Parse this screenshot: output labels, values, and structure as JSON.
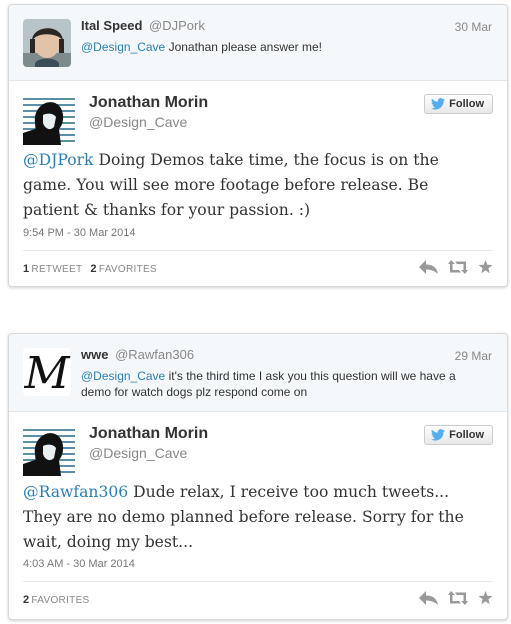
{
  "tweets": [
    {
      "parent": {
        "name": "Ital Speed",
        "handle": "@DJPork",
        "date": "30 Mar",
        "mention": "@Design_Cave",
        "text": " Jonathan please answer me!"
      },
      "author": {
        "name": "Jonathan Morin",
        "handle": "@Design_Cave"
      },
      "follow_label": "Follow",
      "mention": "@DJPork",
      "text": " Doing Demos take time, the focus is on the game. You will see more footage before release. Be patient & thanks for your passion. :)",
      "timestamp": "9:54 PM - 30 Mar 2014",
      "stats": {
        "retweets_count": "1",
        "retweets_label": "RETWEET",
        "favorites_count": "2",
        "favorites_label": "FAVORITES"
      },
      "actions": [
        "reply-icon",
        "retweet-icon",
        "favorite-icon"
      ]
    },
    {
      "parent": {
        "name": "wwe",
        "handle": "@Rawfan306",
        "date": "29 Mar",
        "mention": "@Design_Cave",
        "text": " it's the third time I ask you this question will we have a demo for watch dogs plz respond come on"
      },
      "author": {
        "name": "Jonathan Morin",
        "handle": "@Design_Cave"
      },
      "follow_label": "Follow",
      "mention": "@Rawfan306",
      "text": " Dude relax, I receive too much tweets... They are no demo planned before release. Sorry for the wait, doing my best...",
      "timestamp": "4:03 AM - 30 Mar 2014",
      "stats": {
        "favorites_count": "2",
        "favorites_label": "FAVORITES"
      },
      "actions": [
        "reply-icon",
        "retweet-icon",
        "favorite-icon"
      ]
    }
  ],
  "colors": {
    "link": "#2a7fb8",
    "twitter_bird": "#55acee",
    "icon_gray": "#999999"
  }
}
